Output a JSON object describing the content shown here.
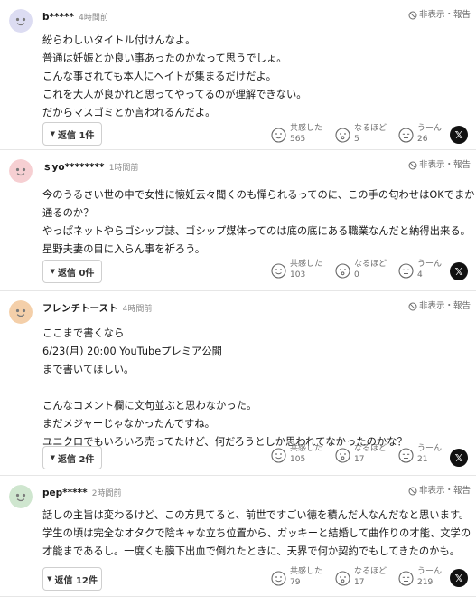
{
  "ui": {
    "hide": "非表示",
    "report": "報告",
    "separator": "・",
    "reactions": [
      "共感した",
      "なるほど",
      "うーん"
    ],
    "x_glyph": "𝕏"
  },
  "colors": {
    "avatar_blue": "#dcdcf2",
    "avatar_pink": "#f6cfd2",
    "avatar_orange": "#f4cfa9",
    "avatar_green": "#cfe6cf"
  },
  "comments": [
    {
      "user": "b*****",
      "time": "4時間前",
      "lines": [
        "紛らわしいタイトル付けんなよ。",
        "普通は妊娠とか良い事あったのかなって思うでしょ。",
        "こんな事されても本人にヘイトが集まるだけだよ。",
        "これを大人が良かれと思ってやってるのが理解できない。",
        "だからマスゴミとか言われるんだよ。"
      ],
      "reply": "返信 1件",
      "counts": [
        "565",
        "5",
        "26"
      ]
    },
    {
      "user": "ｓyo********",
      "time": "1時間前",
      "lines": [
        "今のうるさい世の中で女性に懐妊云々聞くのも憚られるってのに、この手の匂わせはOKでまかり",
        "通るのか？",
        "やっぱネットやらゴシップ誌、ゴシップ媒体ってのは底の底にある職業なんだと納得出来る。",
        "星野夫妻の目に入らん事を祈ろう。"
      ],
      "reply": "返信 0件",
      "counts": [
        "103",
        "0",
        "4"
      ]
    },
    {
      "user": "フレンチトースト",
      "time": "4時間前",
      "lines": [
        "ここまで書くなら",
        "6/23(月) 20:00 YouTubeプレミア公開",
        "まで書いてほしい。",
        "",
        "こんなコメント欄に文句並ぶと思わなかった。",
        "まだメジャーじゃなかったんですね。",
        "ユニクロでもいろいろ売ってたけど、何だろうとしか思われてなかったのかな？"
      ],
      "reply": "返信 2件",
      "counts": [
        "105",
        "17",
        "21"
      ]
    },
    {
      "user": "pep*****",
      "time": "2時間前",
      "lines": [
        "話しの主旨は変わるけど、この方見てると、前世ですごい徳を積んだ人なんだなと思います。",
        "学生の頃は完全なオタクで陰キャな立ち位置から、ガッキーと結婚して曲作りの才能、文学の",
        "才能まであるし。一度くも膜下出血で倒れたときに、天界で何か契約でもしてきたのかも。"
      ],
      "reply": "返信 12件",
      "counts": [
        "79",
        "17",
        "219"
      ]
    }
  ]
}
